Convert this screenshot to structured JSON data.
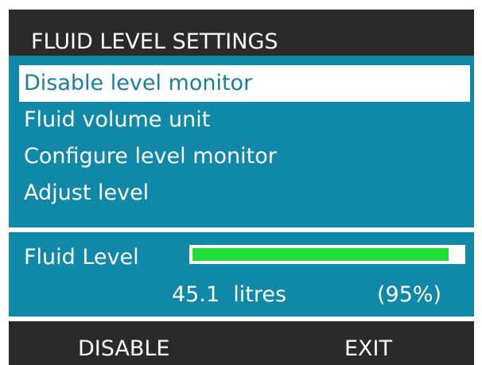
{
  "header": {
    "title": "FLUID LEVEL SETTINGS"
  },
  "menu": {
    "selected_index": 0,
    "items": [
      {
        "label": "Disable level monitor"
      },
      {
        "label": "Fluid volume unit"
      },
      {
        "label": "Configure level monitor"
      },
      {
        "label": "Adjust level"
      }
    ]
  },
  "fluid_level": {
    "label": "Fluid Level",
    "volume_text": "45.1  litres",
    "percent_text": "(95%)",
    "fill_fraction": 0.95
  },
  "softkeys": {
    "left_label": "DISABLE",
    "right_label": "EXIT"
  },
  "colors": {
    "background": "#2a2a2a",
    "panel": "#1088a8",
    "selection": "#ffffff",
    "selected_text": "#1a7f9c",
    "level_fill": "#22dd33"
  }
}
